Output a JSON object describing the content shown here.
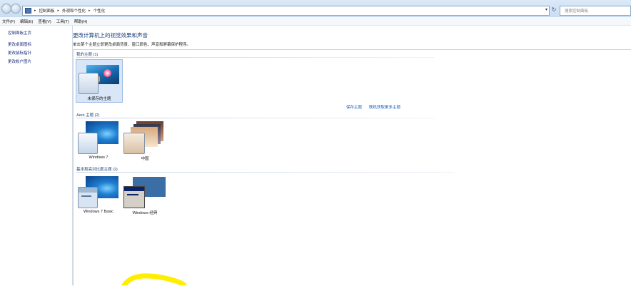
{
  "address_bar": {
    "breadcrumbs": [
      "控制面板",
      "外观和个性化",
      "个性化"
    ],
    "search_placeholder": "搜索控制面板"
  },
  "menu": [
    "文件(F)",
    "编辑(E)",
    "查看(V)",
    "工具(T)",
    "帮助(H)"
  ],
  "left_pane": {
    "home": "控制面板主页",
    "links": [
      "更改桌面图标",
      "更改鼠标指针",
      "更改帐户图片"
    ]
  },
  "main": {
    "title": "更改计算机上的视觉效果和声音",
    "subtitle": "单击某个主题立即更改桌面背景、窗口颜色、声音和屏幕保护程序。",
    "my_themes": {
      "heading": "我的主题 (1)",
      "items": [
        {
          "label": "未保存的主题",
          "selected": true
        }
      ]
    },
    "actions": {
      "save": "保存主题",
      "online": "联机获取更多主题"
    },
    "aero_themes": {
      "heading": "Aero 主题 (2)",
      "items": [
        {
          "label": "Windows 7"
        },
        {
          "label": "中国"
        }
      ]
    },
    "basic_themes": {
      "heading": "基本和高对比度主题 (2)",
      "items": [
        {
          "label": "Windows 7 Basic"
        },
        {
          "label": "Windows 经典"
        }
      ]
    }
  },
  "colors": {
    "link": "#1a3e7a",
    "selection": "#d8e6f7",
    "highlighter": "#ffee00"
  }
}
